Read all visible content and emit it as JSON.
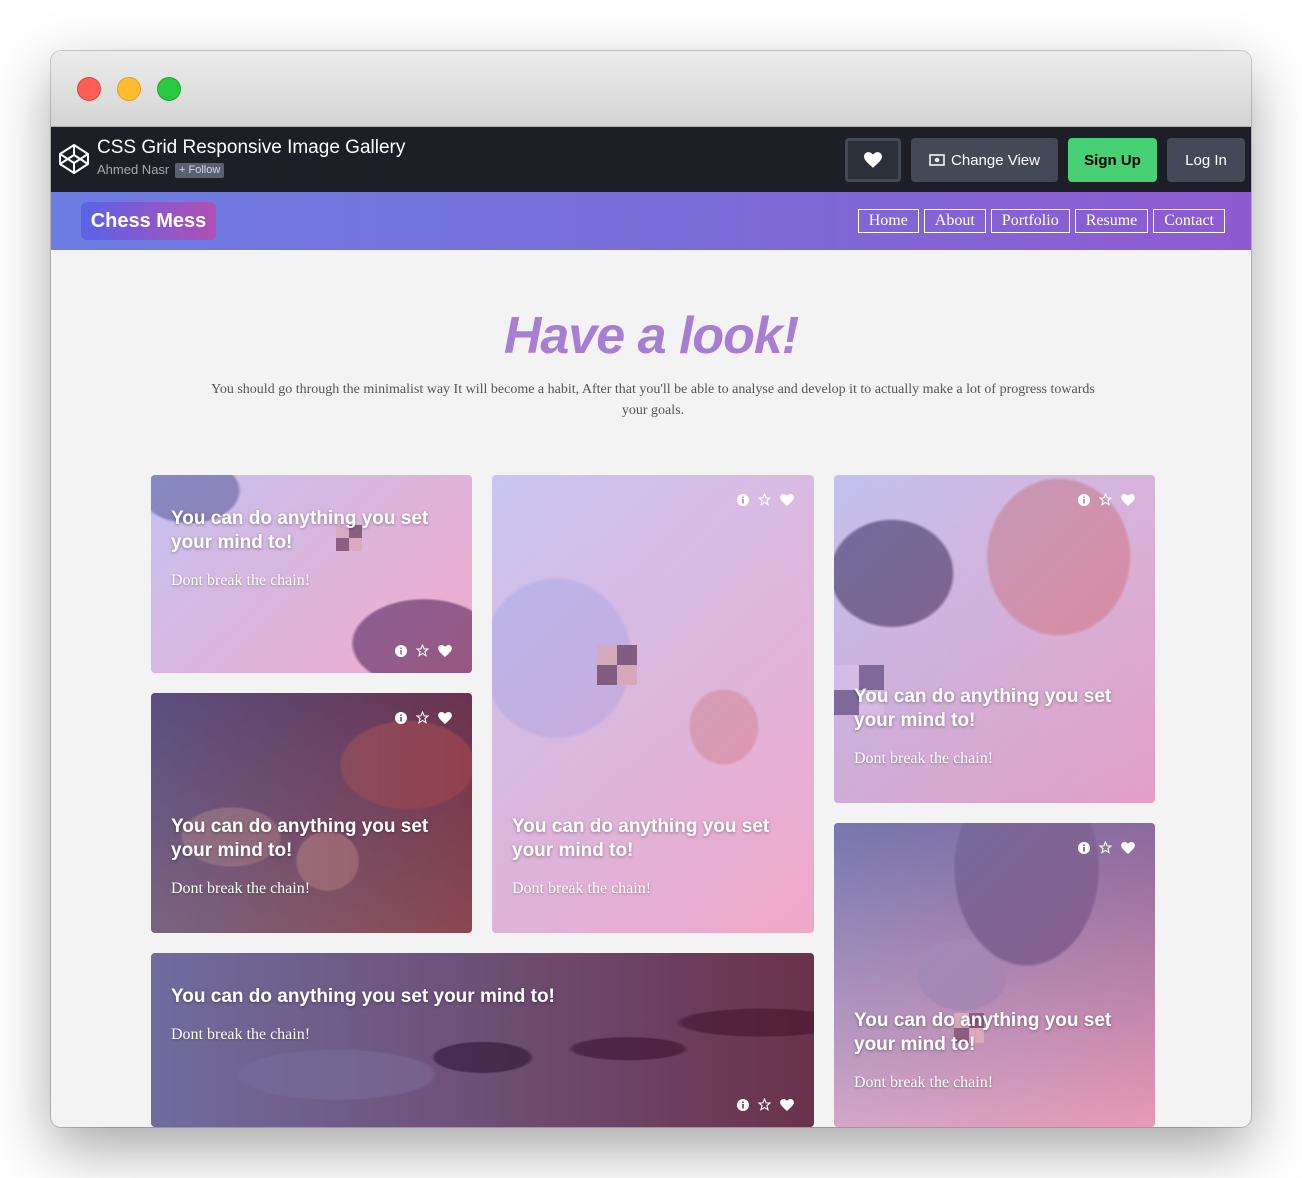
{
  "codepen": {
    "title": "CSS Grid Responsive Image Gallery",
    "author": "Ahmed Nasr",
    "follow_label": "Follow",
    "change_view_label": "Change View",
    "signup_label": "Sign Up",
    "login_label": "Log In"
  },
  "site": {
    "brand": "Chess Mess",
    "nav": [
      "Home",
      "About",
      "Portfolio",
      "Resume",
      "Contact"
    ]
  },
  "hero": {
    "title": "Have a look!",
    "subtitle": "You should go through the minimalist way It will become a habit, After that you'll be able to analyse and develop it to actually make a lot of progress towards your goals."
  },
  "cards": [
    {
      "title": "You can do anything you set your mind to!",
      "subtitle": "Dont break the chain!"
    },
    {
      "title": "You can do anything you set your mind to!",
      "subtitle": "Dont break the chain!"
    },
    {
      "title": "You can do anything you set your mind to!",
      "subtitle": "Dont break the chain!"
    },
    {
      "title": "You can do anything you set your mind to!",
      "subtitle": "Dont break the chain!"
    },
    {
      "title": "You can do anything you set your mind to!",
      "subtitle": "Dont break the chain!"
    },
    {
      "title": "You can do anything you set your mind to!",
      "subtitle": "Dont break the chain!"
    }
  ],
  "card_icons": [
    "info-icon",
    "star-icon",
    "heart-icon"
  ],
  "colors": {
    "codepen_bar": "#1e1f26",
    "signup_green": "#47cf73",
    "nav_gradient_start": "#6d7ee2",
    "nav_gradient_end": "#8f5ad0",
    "hero_title": "#a77ed2"
  }
}
